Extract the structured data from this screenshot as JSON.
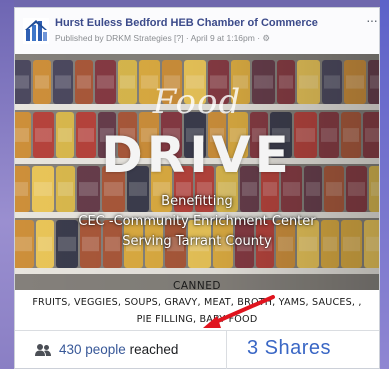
{
  "post": {
    "page_name": "Hurst Euless Bedford HEB Chamber of Commerce",
    "meta": "Published by DRKM Strategies [?] · April 9 at 1:16pm · ⚙",
    "more": "···"
  },
  "flyer": {
    "title_script": "Food",
    "title_main": "DRIVE",
    "line1": "Benefitting",
    "line2": "CEC -Community Enrichment Center",
    "line3": "Serving Tarrant County",
    "canned": "CANNED",
    "items_line1": "FRUITS, VEGGIES, SOUPS, GRAVY, MEAT, BROTH, YAMS, SAUCES, ,",
    "items_line2": "PIE FILLING, BABY FOOD"
  },
  "stats": {
    "reach_count": "430 people",
    "reach_label": " reached",
    "shares": "3 Shares"
  },
  "colors": {
    "page_name": "#3b4a8a",
    "link": "#385898",
    "shares": "#3a67c5",
    "arrow": "#e0141e"
  },
  "icons": {
    "logo": "chamber-logo-icon",
    "people": "people-icon",
    "globe": "globe-icon"
  }
}
